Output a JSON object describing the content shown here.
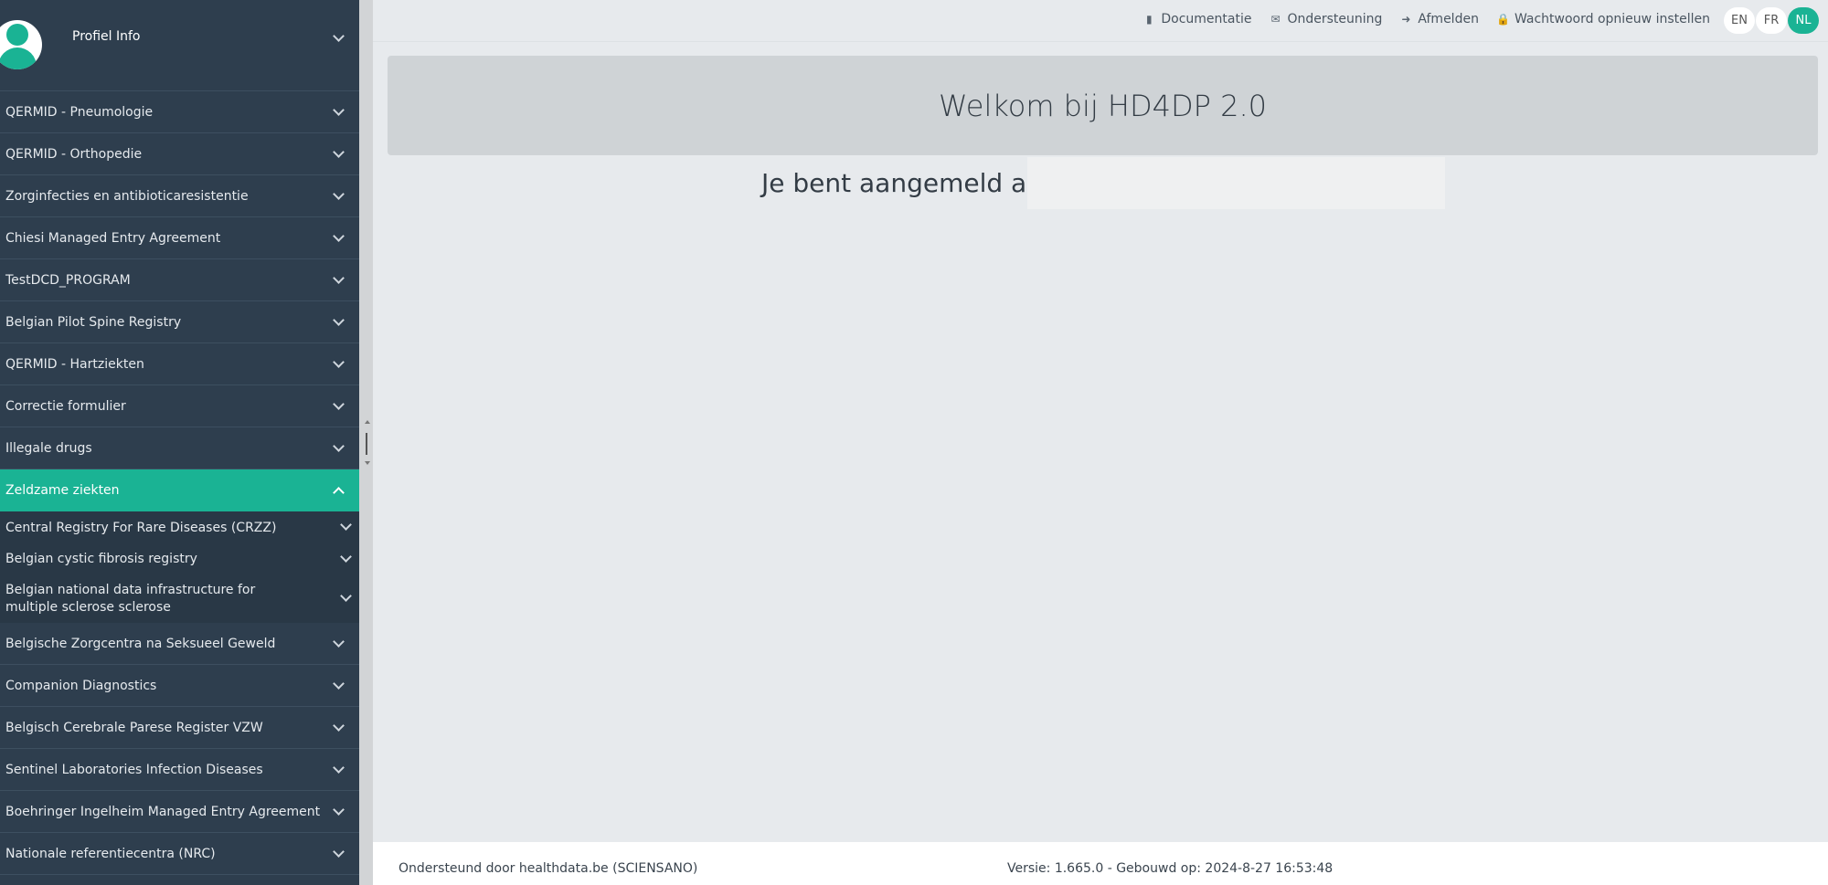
{
  "profile": {
    "label": "Profiel Info"
  },
  "sidebar": {
    "items_before": [
      {
        "label": "QERMID - Pneumologie"
      },
      {
        "label": "QERMID - Orthopedie"
      },
      {
        "label": "Zorginfecties en antibioticaresistentie"
      },
      {
        "label": "Chiesi Managed Entry Agreement"
      },
      {
        "label": "TestDCD_PROGRAM"
      },
      {
        "label": "Belgian Pilot Spine Registry"
      },
      {
        "label": "QERMID - Hartziekten"
      },
      {
        "label": "Correctie formulier"
      },
      {
        "label": "Illegale drugs"
      }
    ],
    "active": {
      "label": "Zeldzame ziekten"
    },
    "sub_items": [
      {
        "label": "Central Registry For Rare Diseases (CRZZ)"
      },
      {
        "label": "Belgian cystic fibrosis registry"
      },
      {
        "label": "Belgian national data infrastructure for multiple sclerose sclerose"
      }
    ],
    "items_after": [
      {
        "label": "Belgische Zorgcentra na Seksueel Geweld"
      },
      {
        "label": "Companion Diagnostics"
      },
      {
        "label": "Belgisch Cerebrale Parese Register VZW"
      },
      {
        "label": "Sentinel Laboratories Infection Diseases"
      },
      {
        "label": "Boehringer Ingelheim Managed Entry Agreement"
      },
      {
        "label": "Nationale referentiecentra (NRC)"
      }
    ]
  },
  "topbar": {
    "documentation": "Documentatie",
    "support": "Ondersteuning",
    "logout": "Afmelden",
    "reset_password": "Wachtwoord opnieuw instellen",
    "languages": [
      "EN",
      "FR",
      "NL"
    ],
    "active_language": "NL"
  },
  "main": {
    "welcome_title": "Welkom bij HD4DP 2.0",
    "logged_in_as": "Je bent aangemeld als"
  },
  "footer": {
    "supported_by": "Ondersteund door healthdata.be (SCIENSANO)",
    "version": "Versie: 1.665.0  -  Gebouwd op: 2024-8-27 16:53:48"
  },
  "colors": {
    "sidebar_bg": "#2e3e4e",
    "accent": "#1ab394",
    "page_bg": "#e7eaed"
  }
}
